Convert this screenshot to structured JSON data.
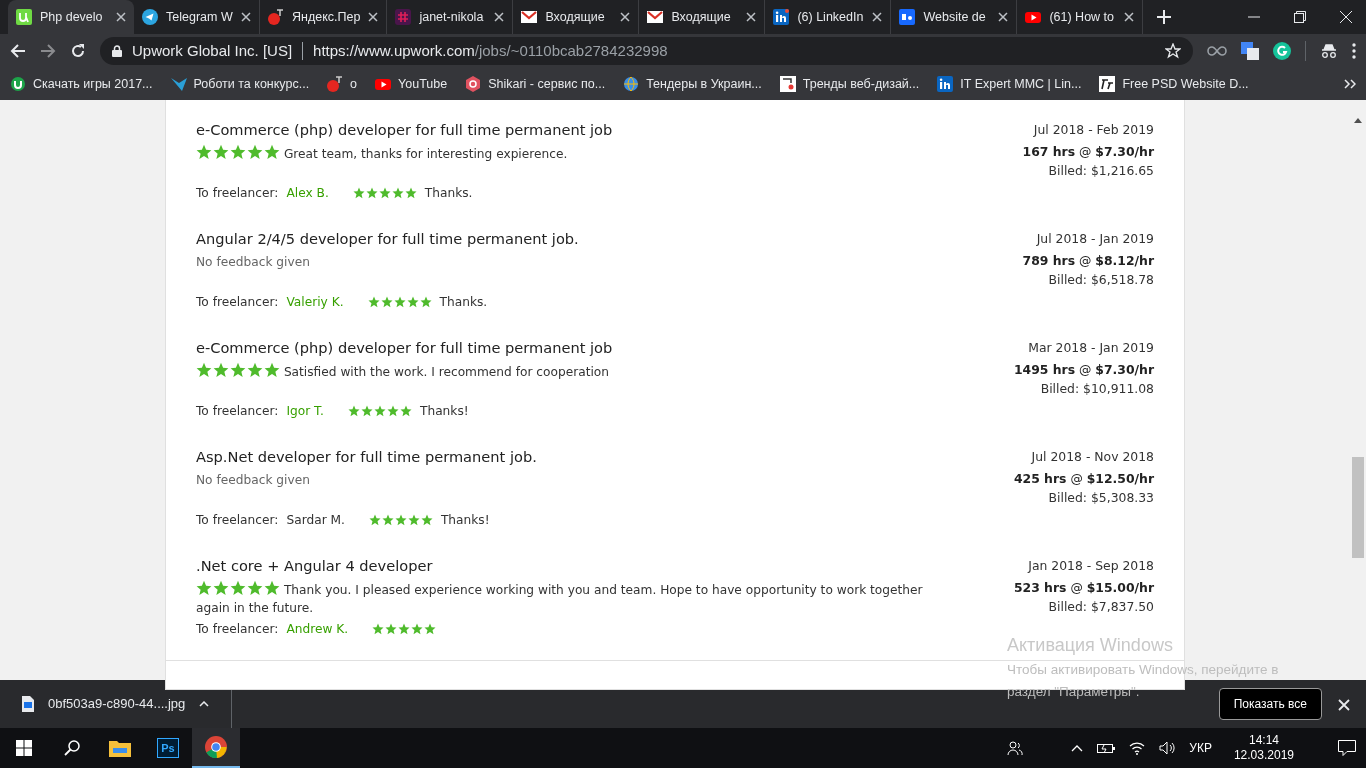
{
  "tabs": [
    {
      "title": "Php develo",
      "selected": true
    },
    {
      "title": "Telegram W",
      "selected": false
    },
    {
      "title": "Яндекс.Пер",
      "selected": false
    },
    {
      "title": "janet-nikola",
      "selected": false
    },
    {
      "title": "Входящие",
      "selected": false
    },
    {
      "title": "Входящие",
      "selected": false
    },
    {
      "title": "(6) LinkedIn",
      "selected": false
    },
    {
      "title": "Website de",
      "selected": false
    },
    {
      "title": "(61) How to",
      "selected": false
    }
  ],
  "address": {
    "site_name": "Upwork Global Inc. [US]",
    "host": "https://www.upwork.com",
    "path": "/jobs/~0110bcab2784232998"
  },
  "bookmarks": [
    "Скачать игры 2017...",
    "Роботи та конкурс...",
    "о",
    "YouTube",
    "Shikari - сервис по...",
    "Тендеры в Украин...",
    "Тренды веб-дизай...",
    "IT Expert MMC | Lin...",
    "Free PSD Website D..."
  ],
  "jobs": [
    {
      "title": "e-Commerce (php) developer for full time permanent job",
      "stars": 5,
      "feedback": "Great team, thanks for interesting expierence.",
      "freelancer_label": "To freelancer:",
      "freelancer": "Alex B.",
      "linked": true,
      "freelancer_rating": {
        "stars": 5
      },
      "reply": "Thanks.",
      "dates": "Jul 2018 - Feb 2019",
      "hours": "**167 hrs** @ **$7.30/hr**",
      "billed": "Billed: $1,216.65"
    },
    {
      "title": "Angular 2/4/5 developer for full time permanent job.",
      "feedback": "No feedback given",
      "freelancer_label": "To freelancer:",
      "freelancer": "Valeriy K.",
      "linked": true,
      "freelancer_rating": {
        "stars": 5
      },
      "reply": "Thanks.",
      "dates": "Jul 2018 - Jan 2019",
      "hours": "**789 hrs** @ **$8.12/hr**",
      "billed": "Billed: $6,518.78"
    },
    {
      "title": "e-Commerce (php) developer for full time permanent job",
      "stars": 5,
      "feedback": "Satisfied with the work. I recommend for cooperation",
      "freelancer_label": "To freelancer:",
      "freelancer": "Igor T.",
      "linked": true,
      "freelancer_rating": {
        "stars": 5
      },
      "reply": "Thanks!",
      "dates": "Mar 2018 - Jan 2019",
      "hours": "**1495 hrs** @ **$7.30/hr**",
      "billed": "Billed: $10,911.08"
    },
    {
      "title": "Asp.Net developer for full time permanent job.",
      "feedback": "No feedback given",
      "freelancer_label": "To freelancer:",
      "freelancer": "Sardar M.",
      "linked": false,
      "freelancer_rating": {
        "stars": 5
      },
      "reply": "Thanks!",
      "dates": "Jul 2018 - Nov 2018",
      "hours": "**425 hrs** @ **$12.50/hr**",
      "billed": "Billed: $5,308.33"
    },
    {
      "title": ".Net core + Angular 4 developer",
      "stars": 5,
      "feedback": "Thank you. I pleased experience working with you and team. Hope to have opportunity to work together again in the future.",
      "freelancer_label": "To freelancer:",
      "freelancer": "Andrew K.",
      "linked": true,
      "freelancer_rating": {
        "stars": 5
      },
      "dates": "Jan 2018 - Sep 2018",
      "hours": "**523 hrs** @ **$15.00/hr**",
      "billed": "Billed: $7,837.50"
    }
  ],
  "download": {
    "file": "0bf503a9-c890-44....jpg",
    "show_all": "Показать все"
  },
  "activation": {
    "title": "Активация Windows",
    "text": "Чтобы активировать Windows, перейдите в раздел \"Параметры\"."
  },
  "taskbar": {
    "photoshop_label": "Ps",
    "language": "УКР",
    "time": "14:14",
    "date": "12.03.2019"
  }
}
